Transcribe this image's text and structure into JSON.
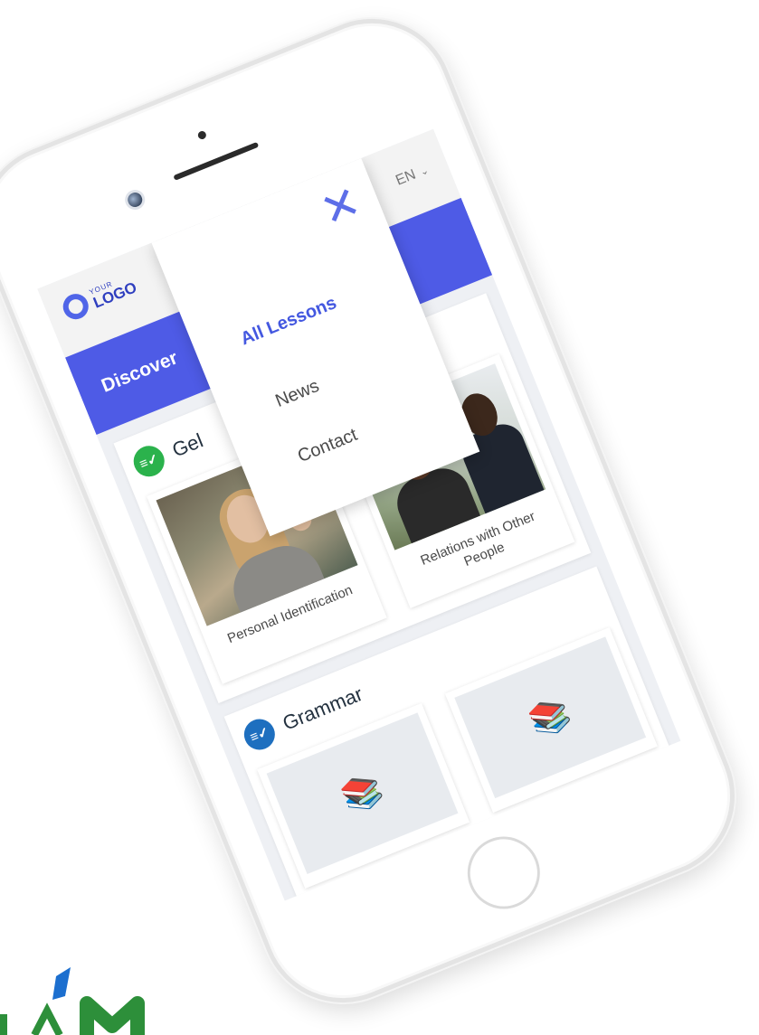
{
  "app": {
    "logo": {
      "top_text": "YOUR",
      "main_text": "LOGO"
    },
    "language": {
      "value": "EN",
      "chevron_icon": "chevron-down-icon"
    },
    "hero": {
      "title": "Discover"
    },
    "nav_menu": {
      "close_icon": "close-icon",
      "items": [
        {
          "label": "All Lessons",
          "active": true
        },
        {
          "label": "News",
          "active": false
        },
        {
          "label": "Contact",
          "active": false
        }
      ]
    },
    "sections": [
      {
        "title": "Gel",
        "icon": "checklist-icon",
        "icon_color": "#2bb24c",
        "cards": [
          {
            "caption": "Personal Identification"
          },
          {
            "caption": "Relations with Other People"
          }
        ]
      },
      {
        "title": "Grammar",
        "icon": "checklist-icon",
        "icon_color": "#1e6fbf",
        "cards": [
          {
            "caption": ""
          },
          {
            "caption": ""
          }
        ]
      }
    ]
  },
  "colors": {
    "accent": "#4e5be6",
    "menu_active": "#4458e0",
    "brand_green": "#2d8f3a",
    "brand_blue": "#1c6fcf"
  }
}
